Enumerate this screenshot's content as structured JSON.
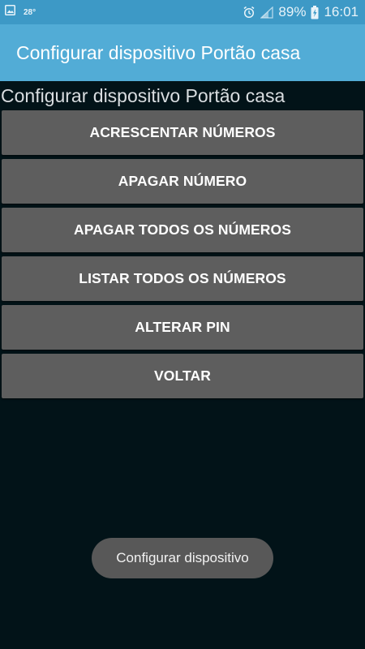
{
  "status_bar": {
    "temperature": "28°",
    "battery_percent": "89%",
    "time": "16:01",
    "icons": [
      "gallery-icon",
      "alarm-icon",
      "signal-icon",
      "battery-charging-icon"
    ]
  },
  "action_bar": {
    "title": "Configurar dispositivo Portão casa"
  },
  "page": {
    "heading": "Configurar dispositivo Portão casa"
  },
  "buttons": [
    {
      "label": "ACRESCENTAR NÚMEROS"
    },
    {
      "label": "APAGAR NÚMERO"
    },
    {
      "label": "APAGAR TODOS OS NÚMEROS"
    },
    {
      "label": "LISTAR TODOS OS NÚMEROS"
    },
    {
      "label": "ALTERAR PIN"
    },
    {
      "label": "VOLTAR"
    }
  ],
  "toast": {
    "message": "Configurar dispositivo"
  },
  "colors": {
    "status_bar": "#3d99c6",
    "action_bar": "#52acd6",
    "background": "#021318",
    "button": "#5e5e5e",
    "toast": "#585858"
  }
}
